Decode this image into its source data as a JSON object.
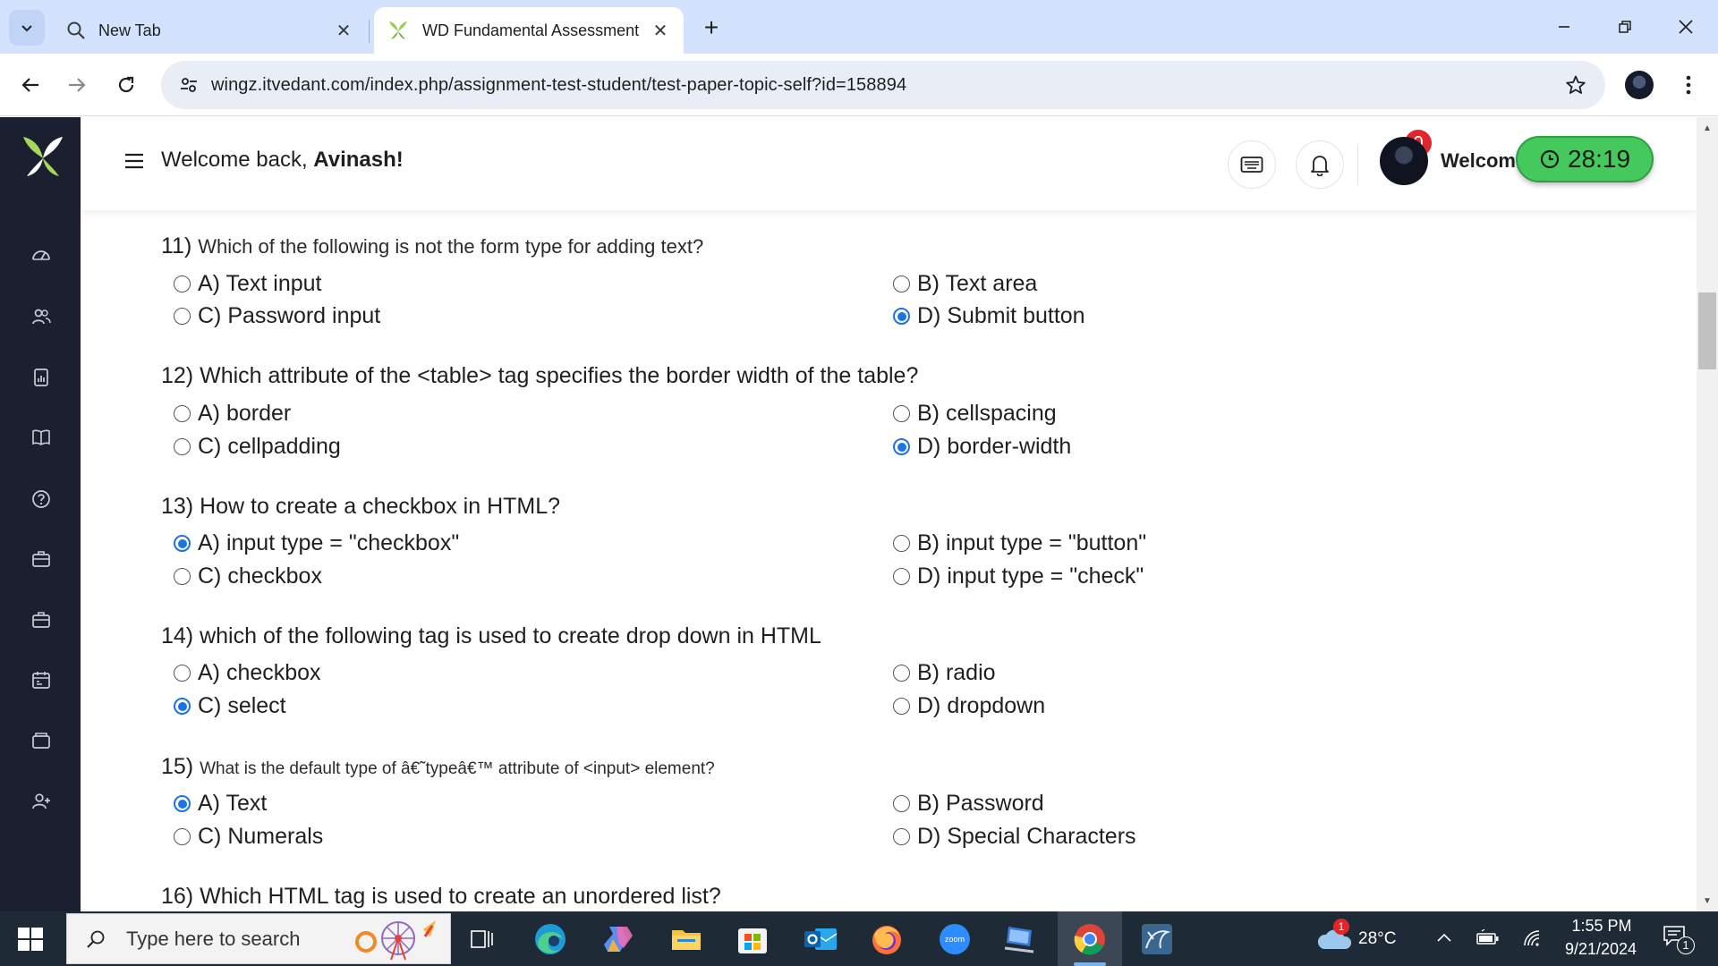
{
  "browser": {
    "tabs": [
      {
        "title": "New Tab",
        "active": false
      },
      {
        "title": "WD Fundamental Assessment",
        "active": true
      }
    ],
    "url": "wingz.itvedant.com/index.php/assignment-test-student/test-paper-topic-self?id=158894"
  },
  "header": {
    "welcome_prefix": "Welcome back,",
    "user_name": "Avinash!",
    "notifications_count": "0",
    "right_welcome": "Welcom",
    "timer": "28:19"
  },
  "sidebar": {
    "icons": [
      "dashboard-icon",
      "users-icon",
      "report-icon",
      "book-icon",
      "help-icon",
      "briefcase-icon",
      "briefcase-alt-icon",
      "calendar-icon",
      "folder-icon",
      "add-user-icon"
    ]
  },
  "questions": [
    {
      "number": "11)",
      "text": "Which of the following is not the form type for adding text?",
      "options": [
        {
          "label": "A) Text input",
          "selected": false
        },
        {
          "label": "B) Text area",
          "selected": false
        },
        {
          "label": "C) Password input",
          "selected": false
        },
        {
          "label": "D) Submit button",
          "selected": true
        }
      ]
    },
    {
      "number": "12)",
      "text": "Which attribute of the <table> tag specifies the border width of the table?",
      "options": [
        {
          "label": "A) border",
          "selected": false
        },
        {
          "label": "B) cellspacing",
          "selected": false
        },
        {
          "label": "C) cellpadding",
          "selected": false
        },
        {
          "label": "D) border-width",
          "selected": true
        }
      ]
    },
    {
      "number": "13)",
      "text": "How to create a checkbox in HTML?",
      "options": [
        {
          "label": "A) input type = \"checkbox\"",
          "selected": true
        },
        {
          "label": "B) input type = \"button\"",
          "selected": false
        },
        {
          "label": "C) checkbox",
          "selected": false
        },
        {
          "label": "D) input type = \"check\"",
          "selected": false
        }
      ]
    },
    {
      "number": "14)",
      "text": "which of the following tag is used to create drop down in HTML",
      "options": [
        {
          "label": "A) checkbox",
          "selected": false
        },
        {
          "label": "B) radio",
          "selected": false
        },
        {
          "label": "C) select",
          "selected": true
        },
        {
          "label": "D) dropdown",
          "selected": false
        }
      ]
    },
    {
      "number": "15)",
      "text": "What is the default type of â€˜typeâ€™ attribute of <input> element?",
      "options": [
        {
          "label": "A) Text",
          "selected": true
        },
        {
          "label": "B) Password",
          "selected": false
        },
        {
          "label": "C) Numerals",
          "selected": false
        },
        {
          "label": "D) Special Characters",
          "selected": false
        }
      ]
    },
    {
      "number": "16)",
      "text": "Which HTML tag is used to create an unordered list?",
      "options": []
    }
  ],
  "taskbar": {
    "search_placeholder": "Type here to search",
    "apps": [
      "task-view-icon",
      "edge-icon",
      "copilot-icon",
      "file-explorer-icon",
      "microsoft-store-icon",
      "outlook-icon",
      "firefox-icon",
      "zoom-icon",
      "remote-desktop-icon",
      "chrome-icon",
      "mysql-workbench-icon"
    ],
    "zoom_label": "zoom",
    "weather_badge": "1",
    "temperature": "28°C",
    "time": "1:55 PM",
    "date": "9/21/2024",
    "notification_count": "1"
  }
}
